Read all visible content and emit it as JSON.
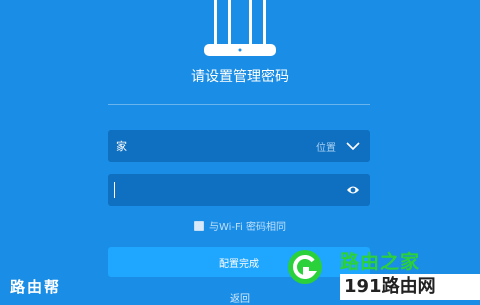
{
  "title": "请设置管理密码",
  "wifi_name": {
    "value": "家",
    "location_label": "位置"
  },
  "password": {
    "value": ""
  },
  "sync_option": {
    "label": "与Wi-Fi 密码相同",
    "checked": false
  },
  "submit_label": "配置完成",
  "back_label": "返回",
  "watermark": {
    "left_text": "路由帮",
    "right_cn": "路由之家",
    "right_site": "191路由网"
  },
  "colors": {
    "background": "#1a8de6",
    "field": "#0f6fc0",
    "button": "#1fa6ff",
    "watermark_green": "#2bd13a"
  },
  "icons": [
    "router-icon",
    "chevron-down-icon",
    "eye-icon",
    "checkbox-icon",
    "watermark-logo-icon"
  ]
}
